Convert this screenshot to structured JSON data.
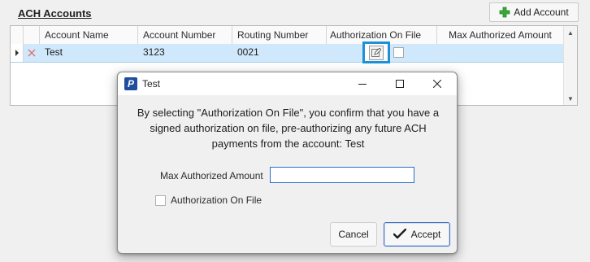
{
  "section": {
    "title": "ACH Accounts"
  },
  "toolbar": {
    "add_account_label": "Add Account"
  },
  "grid": {
    "columns": [
      "Account Name",
      "Account Number",
      "Routing Number",
      "Authorization On File",
      "Max Authorized Amount"
    ],
    "rows": [
      {
        "account_name": "Test",
        "account_number": "3123",
        "routing_number": "0021",
        "authorization_on_file": false,
        "max_authorized_amount": ""
      }
    ]
  },
  "dialog": {
    "title": "Test",
    "app_icon_letter": "P",
    "message": "By selecting \"Authorization On File\", you confirm that you have a signed authorization on file, pre-authorizing any future ACH payments from the account: Test",
    "max_amount_label": "Max Authorized Amount",
    "max_amount_value": "",
    "authorization_label": "Authorization On File",
    "authorization_checked": false,
    "cancel_label": "Cancel",
    "accept_label": "Accept"
  },
  "colors": {
    "selected_row": "#cfe8fb",
    "highlight_border": "#1e90d8",
    "add_icon": "#3aa53a",
    "delete_icon": "#e07070",
    "app_icon": "#1f4e9c"
  },
  "icons": {
    "add": "plus-icon",
    "delete": "delete-x-icon",
    "edit": "edit-icon",
    "row_indicator": "row-indicator-icon",
    "accept": "checkmark-icon"
  }
}
